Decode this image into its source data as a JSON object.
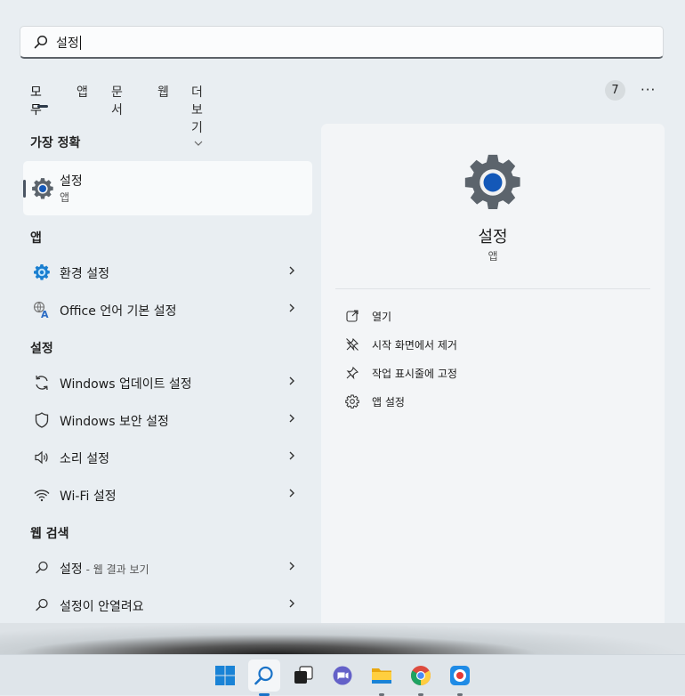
{
  "search": {
    "value": "설정"
  },
  "tabs": [
    "모두",
    "앱",
    "문서",
    "웹",
    "더 보기"
  ],
  "count_badge": "7",
  "more_label": "···",
  "sections": {
    "best": "가장 정확",
    "apps": "앱",
    "settings": "설정",
    "web": "웹 검색"
  },
  "best_match": {
    "name": "설정",
    "type": "앱"
  },
  "apps": [
    {
      "label": "환경 설정"
    },
    {
      "label": "Office 언어 기본 설정"
    }
  ],
  "settings": [
    {
      "label": "Windows 업데이트 설정"
    },
    {
      "label": "Windows 보안 설정"
    },
    {
      "label": "소리 설정"
    },
    {
      "label": "Wi-Fi 설정"
    }
  ],
  "web": [
    {
      "label": "설정",
      "suffix": " - 웹 결과 보기"
    },
    {
      "label": "설정이 안열려요",
      "suffix": ""
    }
  ],
  "preview": {
    "title": "설정",
    "subtitle": "앱",
    "actions": [
      {
        "label": "열기",
        "icon": "open-icon"
      },
      {
        "label": "시작 화면에서 제거",
        "icon": "unpin-icon"
      },
      {
        "label": "작업 표시줄에 고정",
        "icon": "pin-icon"
      },
      {
        "label": "앱 설정",
        "icon": "gear-icon"
      }
    ]
  },
  "taskbar": [
    "start-icon",
    "search-icon",
    "task-view-icon",
    "chat-icon",
    "file-explorer-icon",
    "chrome-icon",
    "screen-recorder-icon"
  ],
  "colors": {
    "accent": "#1a73c8",
    "gear": "#5c646c"
  }
}
